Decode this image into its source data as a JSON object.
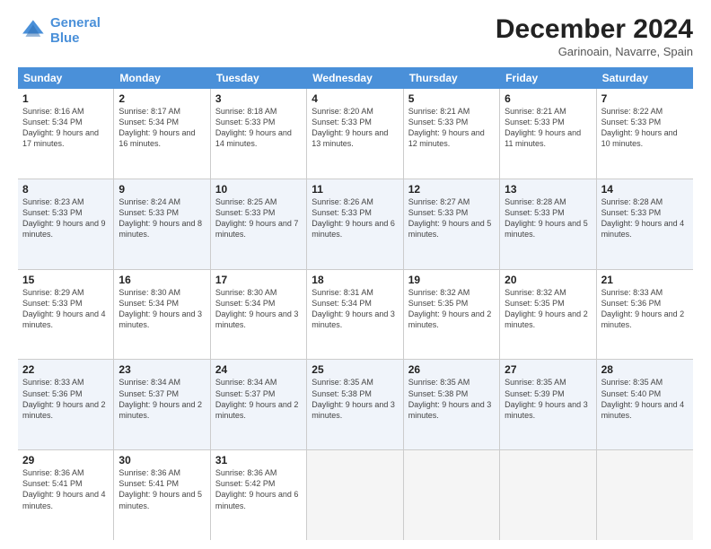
{
  "logo": {
    "line1": "General",
    "line2": "Blue"
  },
  "title": "December 2024",
  "location": "Garinoain, Navarre, Spain",
  "header_days": [
    "Sunday",
    "Monday",
    "Tuesday",
    "Wednesday",
    "Thursday",
    "Friday",
    "Saturday"
  ],
  "rows": [
    {
      "shade": false,
      "cells": [
        {
          "day": "1",
          "text": "Sunrise: 8:16 AM\nSunset: 5:34 PM\nDaylight: 9 hours and 17 minutes."
        },
        {
          "day": "2",
          "text": "Sunrise: 8:17 AM\nSunset: 5:34 PM\nDaylight: 9 hours and 16 minutes."
        },
        {
          "day": "3",
          "text": "Sunrise: 8:18 AM\nSunset: 5:33 PM\nDaylight: 9 hours and 14 minutes."
        },
        {
          "day": "4",
          "text": "Sunrise: 8:20 AM\nSunset: 5:33 PM\nDaylight: 9 hours and 13 minutes."
        },
        {
          "day": "5",
          "text": "Sunrise: 8:21 AM\nSunset: 5:33 PM\nDaylight: 9 hours and 12 minutes."
        },
        {
          "day": "6",
          "text": "Sunrise: 8:21 AM\nSunset: 5:33 PM\nDaylight: 9 hours and 11 minutes."
        },
        {
          "day": "7",
          "text": "Sunrise: 8:22 AM\nSunset: 5:33 PM\nDaylight: 9 hours and 10 minutes."
        }
      ]
    },
    {
      "shade": true,
      "cells": [
        {
          "day": "8",
          "text": "Sunrise: 8:23 AM\nSunset: 5:33 PM\nDaylight: 9 hours and 9 minutes."
        },
        {
          "day": "9",
          "text": "Sunrise: 8:24 AM\nSunset: 5:33 PM\nDaylight: 9 hours and 8 minutes."
        },
        {
          "day": "10",
          "text": "Sunrise: 8:25 AM\nSunset: 5:33 PM\nDaylight: 9 hours and 7 minutes."
        },
        {
          "day": "11",
          "text": "Sunrise: 8:26 AM\nSunset: 5:33 PM\nDaylight: 9 hours and 6 minutes."
        },
        {
          "day": "12",
          "text": "Sunrise: 8:27 AM\nSunset: 5:33 PM\nDaylight: 9 hours and 5 minutes."
        },
        {
          "day": "13",
          "text": "Sunrise: 8:28 AM\nSunset: 5:33 PM\nDaylight: 9 hours and 5 minutes."
        },
        {
          "day": "14",
          "text": "Sunrise: 8:28 AM\nSunset: 5:33 PM\nDaylight: 9 hours and 4 minutes."
        }
      ]
    },
    {
      "shade": false,
      "cells": [
        {
          "day": "15",
          "text": "Sunrise: 8:29 AM\nSunset: 5:33 PM\nDaylight: 9 hours and 4 minutes."
        },
        {
          "day": "16",
          "text": "Sunrise: 8:30 AM\nSunset: 5:34 PM\nDaylight: 9 hours and 3 minutes."
        },
        {
          "day": "17",
          "text": "Sunrise: 8:30 AM\nSunset: 5:34 PM\nDaylight: 9 hours and 3 minutes."
        },
        {
          "day": "18",
          "text": "Sunrise: 8:31 AM\nSunset: 5:34 PM\nDaylight: 9 hours and 3 minutes."
        },
        {
          "day": "19",
          "text": "Sunrise: 8:32 AM\nSunset: 5:35 PM\nDaylight: 9 hours and 2 minutes."
        },
        {
          "day": "20",
          "text": "Sunrise: 8:32 AM\nSunset: 5:35 PM\nDaylight: 9 hours and 2 minutes."
        },
        {
          "day": "21",
          "text": "Sunrise: 8:33 AM\nSunset: 5:36 PM\nDaylight: 9 hours and 2 minutes."
        }
      ]
    },
    {
      "shade": true,
      "cells": [
        {
          "day": "22",
          "text": "Sunrise: 8:33 AM\nSunset: 5:36 PM\nDaylight: 9 hours and 2 minutes."
        },
        {
          "day": "23",
          "text": "Sunrise: 8:34 AM\nSunset: 5:37 PM\nDaylight: 9 hours and 2 minutes."
        },
        {
          "day": "24",
          "text": "Sunrise: 8:34 AM\nSunset: 5:37 PM\nDaylight: 9 hours and 2 minutes."
        },
        {
          "day": "25",
          "text": "Sunrise: 8:35 AM\nSunset: 5:38 PM\nDaylight: 9 hours and 3 minutes."
        },
        {
          "day": "26",
          "text": "Sunrise: 8:35 AM\nSunset: 5:38 PM\nDaylight: 9 hours and 3 minutes."
        },
        {
          "day": "27",
          "text": "Sunrise: 8:35 AM\nSunset: 5:39 PM\nDaylight: 9 hours and 3 minutes."
        },
        {
          "day": "28",
          "text": "Sunrise: 8:35 AM\nSunset: 5:40 PM\nDaylight: 9 hours and 4 minutes."
        }
      ]
    },
    {
      "shade": false,
      "cells": [
        {
          "day": "29",
          "text": "Sunrise: 8:36 AM\nSunset: 5:41 PM\nDaylight: 9 hours and 4 minutes."
        },
        {
          "day": "30",
          "text": "Sunrise: 8:36 AM\nSunset: 5:41 PM\nDaylight: 9 hours and 5 minutes."
        },
        {
          "day": "31",
          "text": "Sunrise: 8:36 AM\nSunset: 5:42 PM\nDaylight: 9 hours and 6 minutes."
        },
        {
          "day": "",
          "text": ""
        },
        {
          "day": "",
          "text": ""
        },
        {
          "day": "",
          "text": ""
        },
        {
          "day": "",
          "text": ""
        }
      ]
    }
  ]
}
